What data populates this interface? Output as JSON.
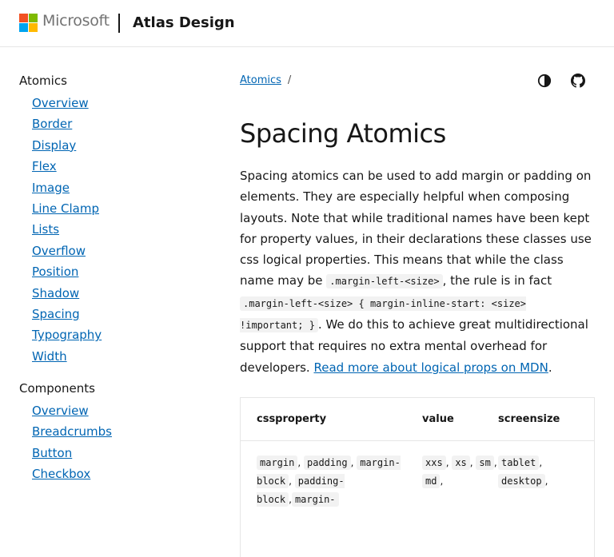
{
  "header": {
    "brand": "Microsoft",
    "title": "Atlas Design",
    "logo_colors": [
      "#f25022",
      "#7fba00",
      "#00a4ef",
      "#ffb900"
    ]
  },
  "sidebar": {
    "sections": [
      {
        "heading": "Atomics",
        "items": [
          "Overview",
          "Border",
          "Display",
          "Flex",
          "Image",
          "Line Clamp",
          "Lists",
          "Overflow",
          "Position",
          "Shadow",
          "Spacing",
          "Typography",
          "Width"
        ]
      },
      {
        "heading": "Components",
        "items": [
          "Overview",
          "Breadcrumbs",
          "Button",
          "Checkbox"
        ]
      }
    ]
  },
  "breadcrumb": {
    "link": "Atomics",
    "separator": "/"
  },
  "icons": {
    "theme": "theme-toggle-icon",
    "github": "github-icon"
  },
  "main": {
    "title": "Spacing Atomics",
    "intro": {
      "p1": "Spacing atomics can be used to add margin or padding on elements. They are especially helpful when composing layouts. Note that while traditional names have been kept for property values, in their declarations these classes use css logical properties. This means that while the class name may be ",
      "code1": ".margin-left-<size>",
      "p2": ", the rule is in fact ",
      "code2": ".margin-left-<size> { margin-inline-start: <size> !important; }",
      "p3": ". We do this to achieve great multidirectional support that requires no extra mental overhead for developers. ",
      "link": "Read more about logical props on MDN",
      "p4": "."
    }
  },
  "table": {
    "headers": [
      "cssproperty",
      "value",
      "screensize"
    ],
    "row": {
      "cssproperty": [
        "margin",
        "padding",
        "margin-block",
        "padding-block",
        "margin-"
      ],
      "value": [
        "xxs",
        "xs",
        "sm",
        "md"
      ],
      "screensize": [
        "tablet",
        "desktop"
      ]
    }
  },
  "colors": {
    "link": "#0065b3",
    "text": "#171717",
    "border": "#e6e6e6",
    "code_bg": "#f2f2f2"
  }
}
